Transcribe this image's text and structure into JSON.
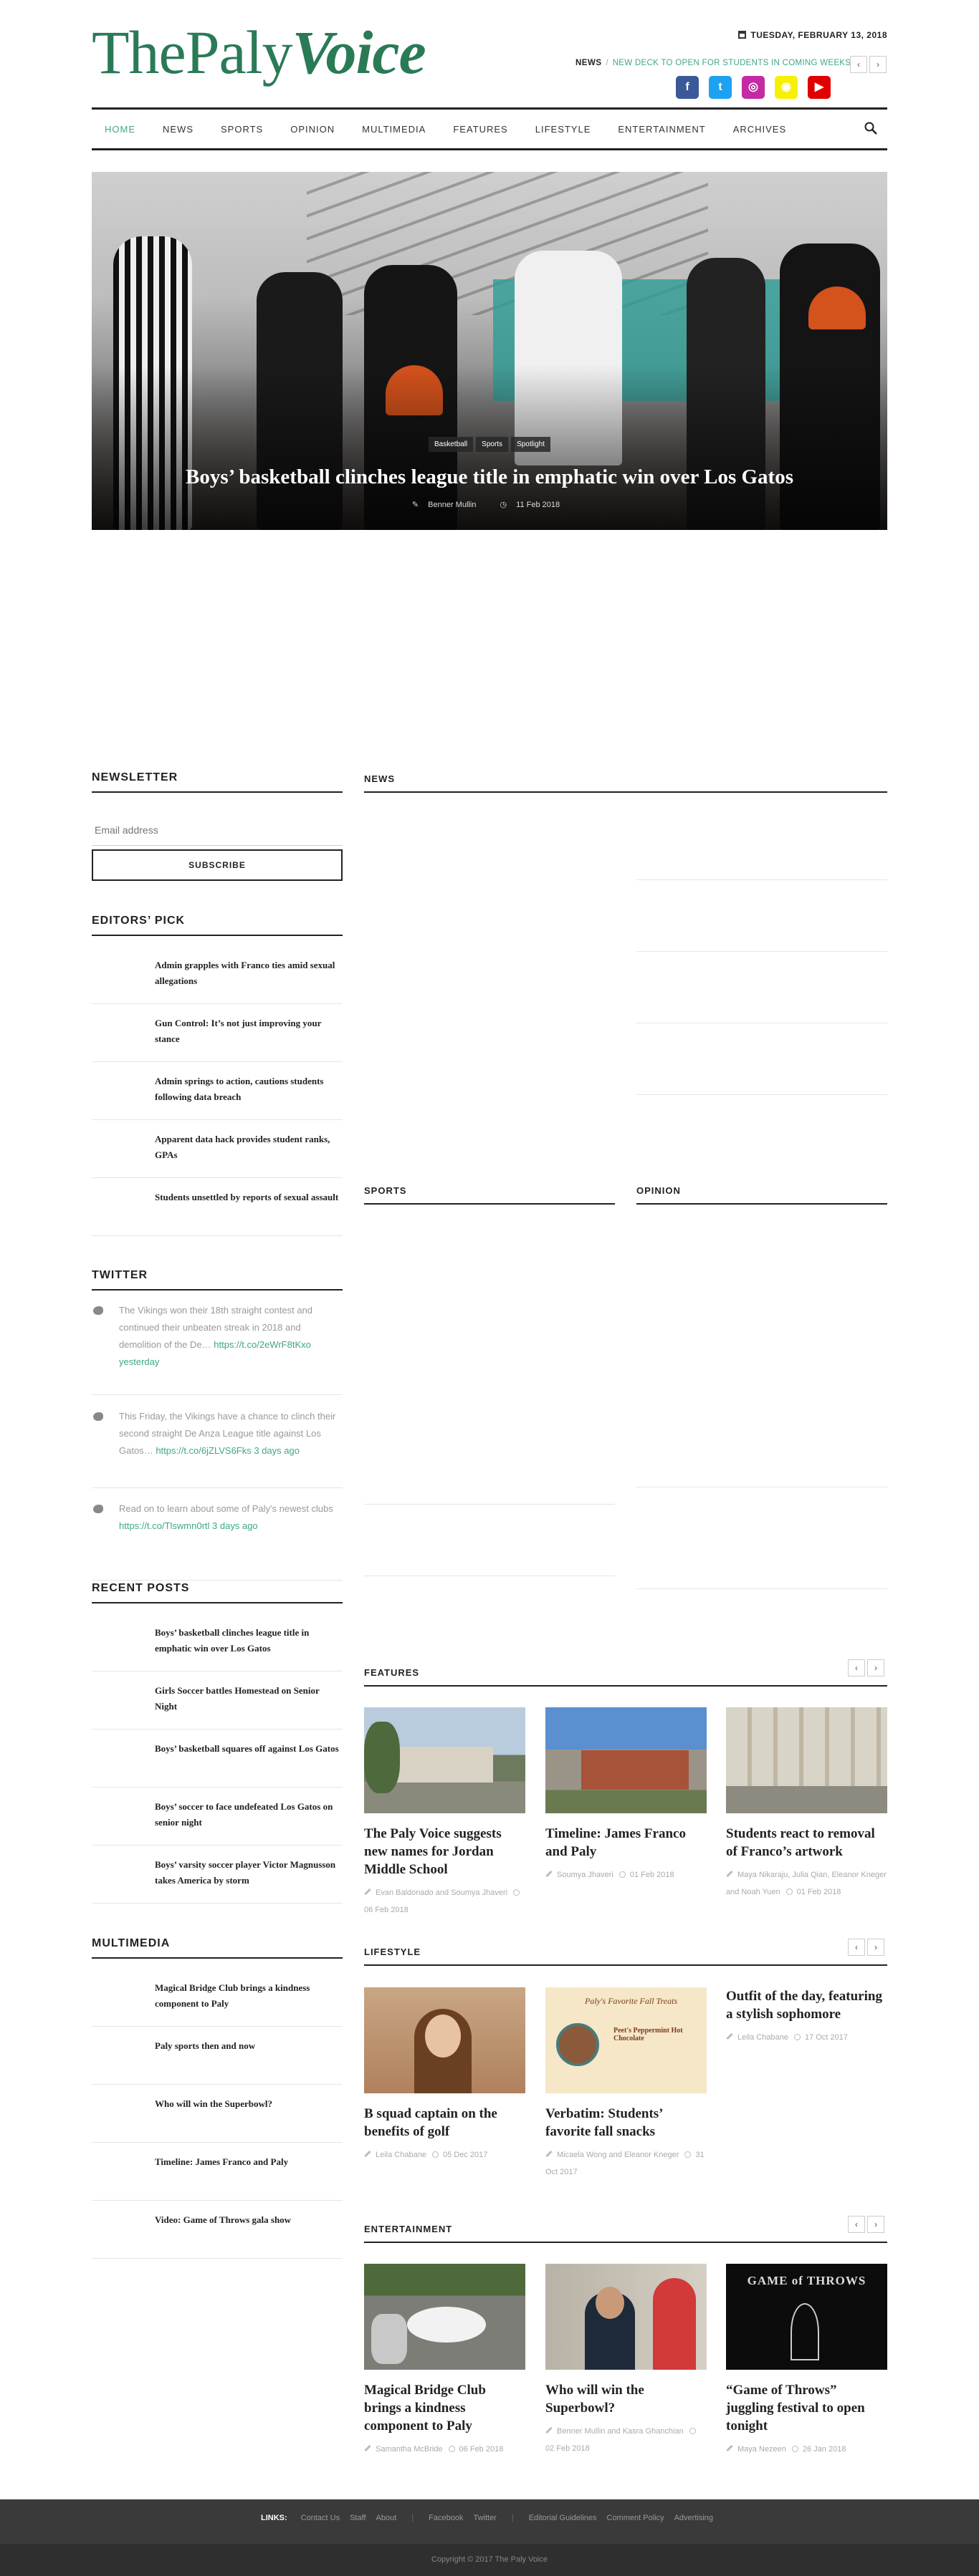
{
  "header": {
    "logo_plain": "ThePaly",
    "logo_bold": "Voice",
    "date": "TUESDAY, FEBRUARY 13, 2018",
    "ticker_label": "NEWS",
    "ticker_sep": "/",
    "ticker_text": "NEW DECK TO OPEN FOR STUDENTS IN COMING WEEKS",
    "prev": "‹",
    "next": "›",
    "social": [
      {
        "name": "facebook",
        "glyph": "f",
        "color": "#3b5998"
      },
      {
        "name": "twitter",
        "glyph": "t",
        "color": "#1da1f2"
      },
      {
        "name": "instagram",
        "glyph": "◎",
        "color": "#c32aa3"
      },
      {
        "name": "snapchat",
        "glyph": "◉",
        "color": "#f7f000"
      },
      {
        "name": "youtube",
        "glyph": "▶",
        "color": "#e00000"
      }
    ]
  },
  "nav": [
    "HOME",
    "NEWS",
    "SPORTS",
    "OPINION",
    "MULTIMEDIA",
    "FEATURES",
    "LIFESTYLE",
    "ENTERTAINMENT",
    "ARCHIVES"
  ],
  "hero": {
    "tags": [
      "Basketball",
      "Sports",
      "Spotlight"
    ],
    "title": "Boys’ basketball clinches league title in emphatic win over Los Gatos",
    "author": "Benner Mullin",
    "date": "11 Feb 2018"
  },
  "sidebar": {
    "newsletter_title": "NEWSLETTER",
    "email_placeholder": "Email address",
    "subscribe": "SUBSCRIBE",
    "editors_title": "EDITORS’ PICK",
    "editors": [
      "Admin grapples with Franco ties amid sexual allegations",
      "Gun Control: It’s not just improving your stance",
      "Admin springs to action, cautions students following data breach",
      "Apparent data hack provides student ranks, GPAs",
      "Students unsettled by reports of sexual assault"
    ],
    "twitter_title": "TWITTER",
    "tweets": [
      {
        "text": "The Vikings won their 18th straight contest and continued their unbeaten streak in 2018 and demolition of the De…",
        "link": "https://t.co/2eWrF8tKxo",
        "time": "yesterday"
      },
      {
        "text": "This Friday, the Vikings have a chance to clinch their second straight De Anza League title against Los Gatos…",
        "link": "https://t.co/6jZLVS6Fks",
        "time": "3 days ago"
      },
      {
        "text": "Read on to learn about some of Paly's newest clubs",
        "link": "https://t.co/Tlswmn0rtl",
        "time": "3 days ago"
      }
    ],
    "recent_title": "RECENT POSTS",
    "recent": [
      "Boys’ basketball clinches league title in emphatic win over Los Gatos",
      "Girls Soccer battles Homestead on Senior Night",
      "Boys’ basketball squares off against Los Gatos",
      "Boys’ soccer to face undefeated Los Gatos on senior night",
      "Boys’ varsity soccer player Victor Magnusson takes America by storm"
    ],
    "multimedia_title": "MULTIMEDIA",
    "multimedia": [
      "Magical Bridge Club brings a kindness component to Paly",
      "Paly sports then and now",
      "Who will win the Superbowl?",
      "Timeline: James Franco and Paly",
      "Video: Game of Throws gala show"
    ]
  },
  "main": {
    "news_title": "NEWS",
    "sports_title": "SPORTS",
    "opinion_title": "OPINION",
    "features_title": "FEATURES",
    "features": [
      {
        "title": "The Paly Voice suggests new names for Jordan Middle School",
        "author": "Evan Baldonado and Soumya Jhaveri",
        "date": "06 Feb 2018"
      },
      {
        "title": "Timeline: James Franco and Paly",
        "author": "Soumya Jhaveri",
        "date": "01 Feb 2018"
      },
      {
        "title": "Students react to removal of Franco’s artwork",
        "author": "Maya Nikaraju, Julia Qian, Eleanor Kneger and Noah Yuen",
        "date": "01 Feb 2018"
      }
    ],
    "lifestyle_title": "LIFESTYLE",
    "lifestyle": [
      {
        "title": "B squad captain on the benefits of golf",
        "author": "Leila Chabane",
        "date": "05 Dec 2017"
      },
      {
        "title": "Verbatim: Students’ favorite fall snacks",
        "author": "Micaela Wong and Eleanor Kneger",
        "date": "31 Oct 2017"
      },
      {
        "title": "Outfit of the day, featuring a stylish sophomore",
        "author": "Leila Chabane",
        "date": "17 Oct 2017"
      }
    ],
    "lifestyle_img2": {
      "heading": "Paly's Favorite Fall Treats",
      "item": "Peet's Peppermint Hot Chocolate"
    },
    "entertainment_title": "ENTERTAINMENT",
    "entertainment": [
      {
        "title": "Magical Bridge Club brings a kindness component to Paly",
        "author": "Samantha McBride",
        "date": "06 Feb 2018"
      },
      {
        "title": "Who will win the Superbowl?",
        "author": "Benner Mullin and Kasra Ghanchian",
        "date": "02 Feb 2018"
      },
      {
        "title": "“Game of Throws” juggling festival to open tonight",
        "author": "Maya Nezeen",
        "date": "26 Jan 2018"
      }
    ],
    "got_text": "GAME of THROWS"
  },
  "footer": {
    "links_label": "LINKS:",
    "links": [
      "Contact Us",
      "Staff",
      "About",
      "Facebook",
      "Twitter",
      "Editorial Guidelines",
      "Comment Policy",
      "Advertising"
    ],
    "copyright": "Copyright © 2017 The Paly Voice"
  }
}
